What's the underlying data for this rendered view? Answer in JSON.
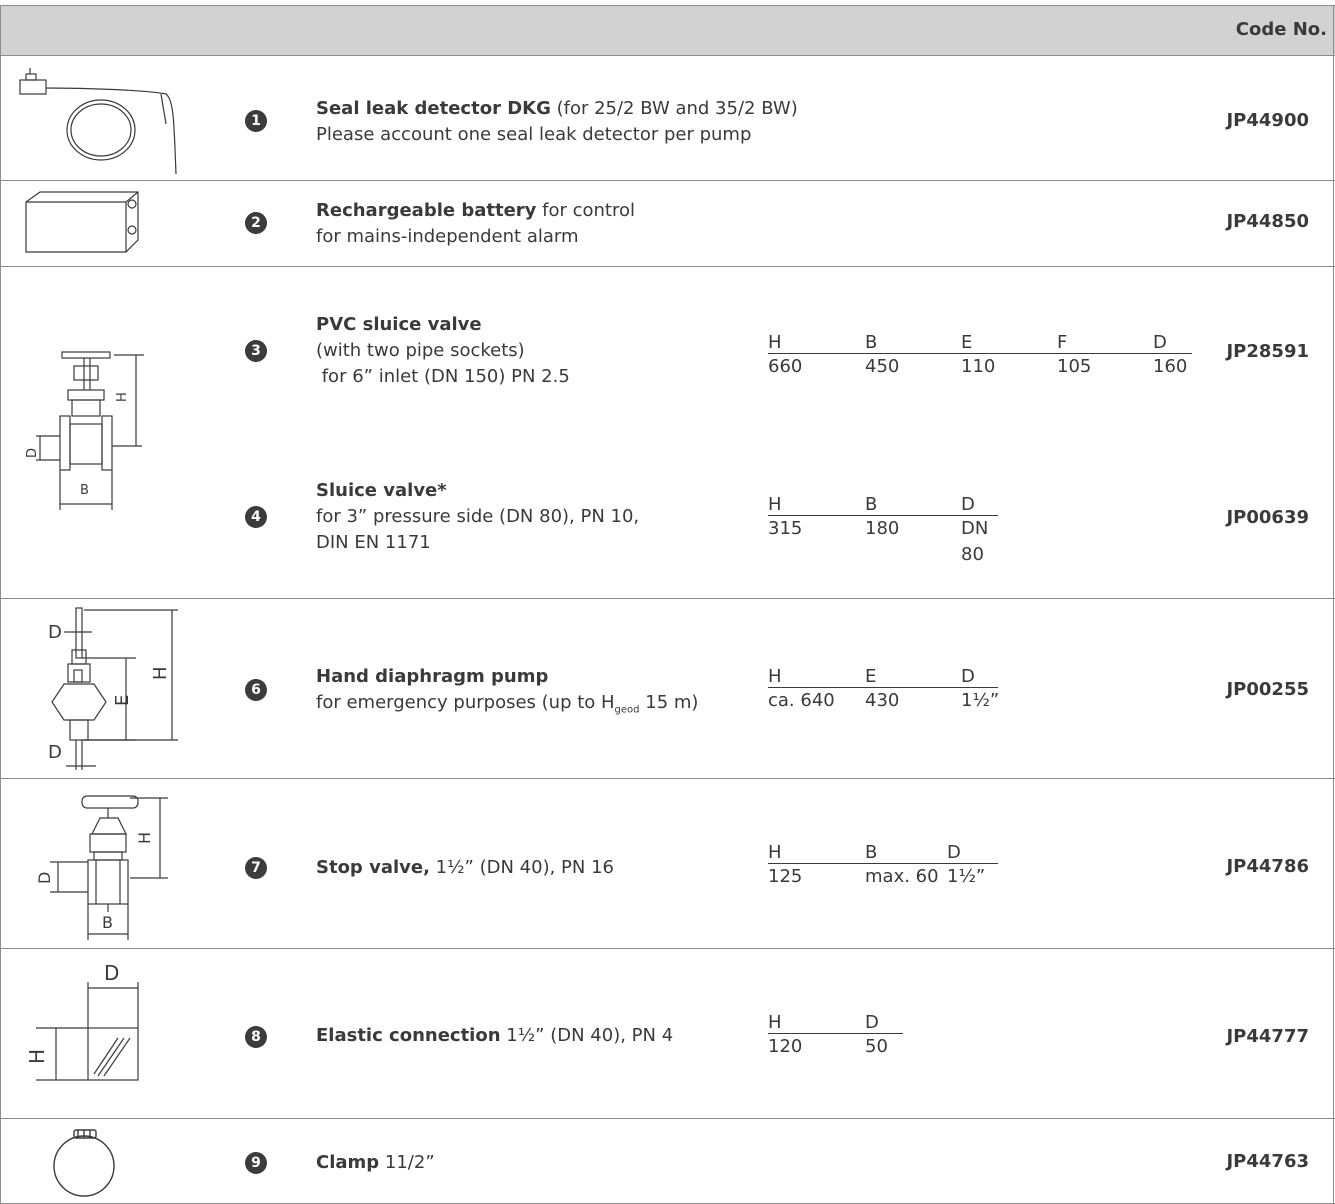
{
  "header": {
    "code_label": "Code No."
  },
  "rows": [
    {
      "num": "1",
      "title": "Seal leak detector DKG",
      "rest": " (for 25/2 BW and 35/2 BW)",
      "line2": "Please account one seal leak detector per pump",
      "code": "JP44900",
      "image_icon": "seal-leak-detector-icon"
    },
    {
      "num": "2",
      "title": "Rechargeable battery",
      "rest": " for control",
      "line2": "for mains-independent alarm",
      "code": "JP44850",
      "image_icon": "battery-icon"
    },
    {
      "num": "3",
      "title": "PVC sluice valve",
      "rest": "",
      "line2": "(with two pipe sockets)",
      "line3": " for 6” inlet (DN 150) PN 2.5",
      "code": "JP28591",
      "dims": {
        "labels": [
          "H",
          "B",
          "E",
          "F",
          "D"
        ],
        "values": [
          "660",
          "450",
          "110",
          "105",
          "160"
        ]
      },
      "image_icon": "sluice-valve-icon"
    },
    {
      "num": "4",
      "title": "Sluice valve*",
      "rest": "",
      "line2": "for 3” pressure side (DN 80), PN 10,",
      "line3": "DIN EN 1171",
      "code": "JP00639",
      "dims": {
        "labels": [
          "H",
          "B",
          "D"
        ],
        "values": [
          "315",
          "180",
          "DN 80"
        ]
      }
    },
    {
      "num": "6",
      "title": "Hand diaphragm pump",
      "rest": "",
      "line2_pre": "for emergency purposes (up to H",
      "line2_sub": "geod",
      "line2_post": " 15 m)",
      "code": "JP00255",
      "dims": {
        "labels": [
          "H",
          "E",
          "D"
        ],
        "values": [
          "ca. 640",
          "430",
          "1½”"
        ]
      },
      "image_icon": "hand-diaphragm-pump-icon"
    },
    {
      "num": "7",
      "title": "Stop valve,",
      "rest": " 1½” (DN 40), PN 16",
      "code": "JP44786",
      "dims": {
        "labels": [
          "H",
          "B",
          "D"
        ],
        "values": [
          "125",
          "max. 60",
          "1½”"
        ]
      },
      "image_icon": "stop-valve-icon"
    },
    {
      "num": "8",
      "title": "Elastic connection",
      "rest": " 1½” (DN 40), PN 4",
      "code": "JP44777",
      "dims": {
        "labels": [
          "H",
          "D"
        ],
        "values": [
          "120",
          "50"
        ]
      },
      "image_icon": "elastic-connection-icon"
    },
    {
      "num": "9",
      "title": "Clamp",
      "rest": " 11/2”",
      "code": "JP44763",
      "image_icon": "clamp-icon"
    }
  ],
  "drawing_labels": {
    "h": "H",
    "b": "B",
    "d": "D",
    "e": "E"
  }
}
